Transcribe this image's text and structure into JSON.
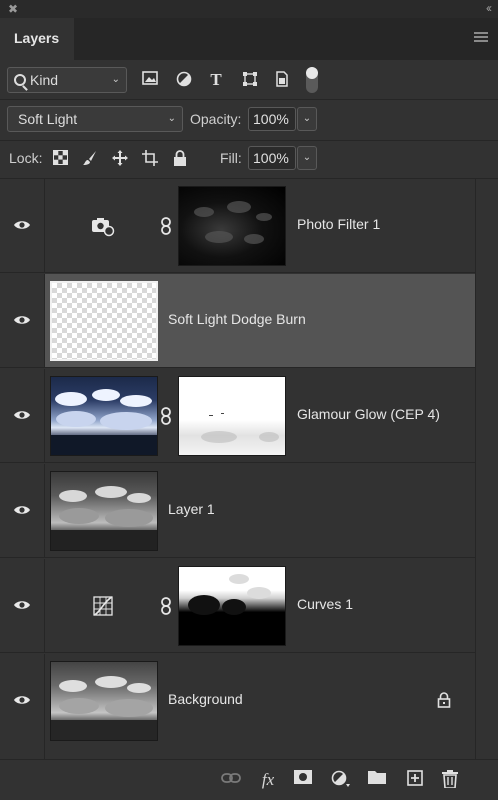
{
  "panel": {
    "tab_label": "Layers",
    "close_glyph": "✖",
    "collapse_glyph": "‹‹"
  },
  "filter": {
    "kind_label": "Kind",
    "icons": [
      "image-filter-icon",
      "adjustment-filter-icon",
      "type-filter-icon",
      "shape-filter-icon",
      "smart-object-filter-icon"
    ]
  },
  "blend": {
    "mode": "Soft Light",
    "opacity_label": "Opacity:",
    "opacity_value": "100%"
  },
  "lock": {
    "label": "Lock:",
    "fill_label": "Fill:",
    "fill_value": "100%"
  },
  "layers": [
    {
      "name": "Photo Filter 1",
      "type": "adjustment",
      "adjustment_icon": "camera-filter-icon",
      "has_mask": true,
      "selected": false
    },
    {
      "name": "Soft Light Dodge Burn",
      "type": "pixel-transparent",
      "has_mask": false,
      "selected": true
    },
    {
      "name": "Glamour Glow (CEP 4)",
      "type": "pixel",
      "has_mask": true,
      "selected": false
    },
    {
      "name": "Layer 1",
      "type": "pixel",
      "has_mask": false,
      "selected": false
    },
    {
      "name": "Curves 1",
      "type": "adjustment",
      "adjustment_icon": "curves-icon",
      "has_mask": true,
      "selected": false
    },
    {
      "name": "Background",
      "type": "pixel",
      "has_mask": false,
      "locked": true,
      "selected": false
    }
  ],
  "bottom_bar": {
    "icons": [
      "link-layers-icon",
      "fx-icon",
      "add-mask-icon",
      "new-adjustment-icon",
      "new-group-icon",
      "new-layer-icon",
      "delete-icon"
    ],
    "fx_label": "fx"
  },
  "colors": {
    "panel_bg": "#323232",
    "selected_row": "#545454",
    "text": "#e6e6e6"
  }
}
